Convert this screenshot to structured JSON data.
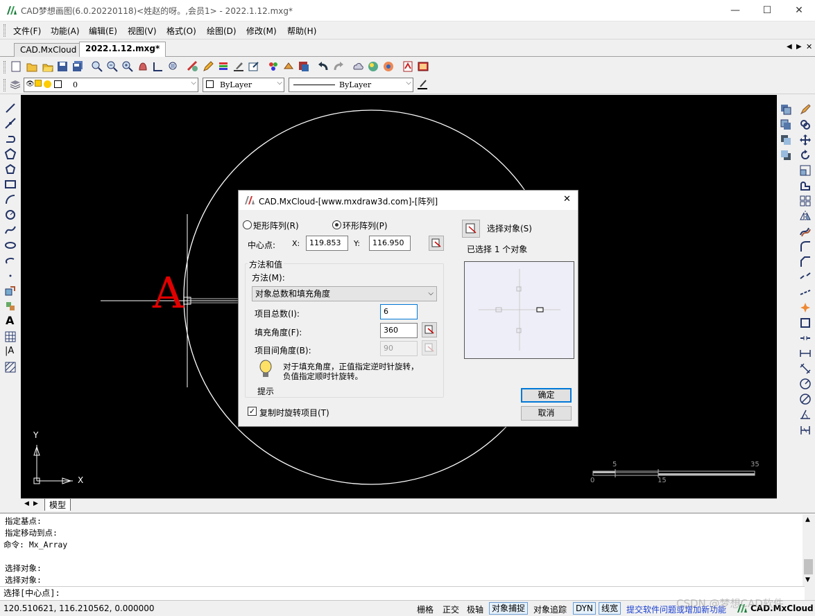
{
  "window": {
    "title": "CAD梦想画图(6.0.20220118)<姓赵的呀。,会员1> - 2022.1.12.mxg*",
    "minimize": "—",
    "maximize": "☐",
    "close": "✕"
  },
  "menu": [
    "文件(F)",
    "功能(A)",
    "编辑(E)",
    "视图(V)",
    "格式(O)",
    "绘图(D)",
    "修改(M)",
    "帮助(H)"
  ],
  "tabs": [
    "CAD.MxCloud",
    "2022.1.12.mxg*"
  ],
  "tab_controls": [
    "◀",
    "▶",
    "✕"
  ],
  "layer_bar": {
    "layer_name": "0",
    "color": "ByLayer",
    "linetype": "ByLayer"
  },
  "canvas": {
    "text_a": "A",
    "ucs_x": "X",
    "ucs_y": "Y",
    "scale_top_1": "5",
    "scale_top_2": "35",
    "scale_bottom_1": "0",
    "scale_bottom_2": "15",
    "colors": {
      "background": "#000000",
      "geometry": "#ffffff",
      "text_a": "#e00000"
    }
  },
  "model_tab": "模型",
  "dialog": {
    "title": "CAD.MxCloud-[www.mxdraw3d.com]-[阵列]",
    "radio_rect": "矩形阵列(R)",
    "radio_polar": "环形阵列(P)",
    "center_label": "中心点:",
    "x_label": "X:",
    "x_value": "119.853",
    "y_label": "Y:",
    "y_value": "116.950",
    "group_method": "方法和值",
    "method_label": "方法(M):",
    "method_value": "对象总数和填充角度",
    "total_label": "项目总数(I):",
    "total_value": "6",
    "fill_label": "填充角度(F):",
    "fill_value": "360",
    "between_label": "项目间角度(B):",
    "between_value": "90",
    "hint_text_1": "对于填充角度，正值指定逆时针旋转，",
    "hint_text_2": "负值指定顺时针旋转。",
    "hint_label": "提示",
    "rotate_check": "复制时旋转项目(T)",
    "select_objects": "选择对象(S)",
    "selected_count": "已选择 1 个对象",
    "ok": "确定",
    "cancel": "取消",
    "close": "✕"
  },
  "command": {
    "lines": [
      "指定基点:",
      "指定移动到点:",
      "命令: Mx_Array",
      "",
      "选择对象:",
      "选择对象:"
    ],
    "prompt": "选择[中心点]:"
  },
  "status": {
    "coords": "120.510621,  116.210562,  0.000000",
    "grid": "栅格",
    "ortho": "正交",
    "polar": "极轴",
    "osnap": "对象捕捉",
    "otrack": "对象追踪",
    "dyn": "DYN",
    "lineweight": "线宽",
    "feedback": "提交软件问题或增加新功能",
    "brand": "CAD.MxCloud",
    "watermark": "CSDN @梦想CAD软件"
  }
}
